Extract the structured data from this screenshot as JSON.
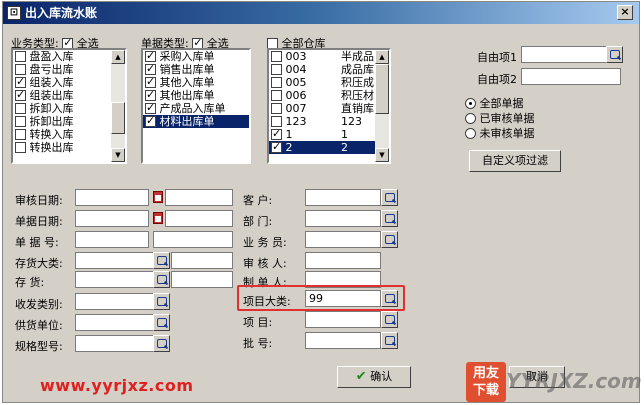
{
  "window": {
    "title": "出入库流水账",
    "close": "×"
  },
  "business": {
    "label": "业务类型:",
    "select_all": "全选",
    "items": [
      "盘盈入库",
      "盘亏出库",
      "组装入库",
      "组装出库",
      "拆卸入库",
      "拆卸出库",
      "转换入库",
      "转换出库"
    ],
    "checked": [
      false,
      false,
      true,
      true,
      false,
      false,
      false,
      false
    ]
  },
  "doc_type": {
    "label": "单据类型:",
    "select_all": "全选",
    "items": [
      "采购入库单",
      "销售出库单",
      "其他入库单",
      "其他出库单",
      "产成品入库单",
      "材料出库单"
    ],
    "checked": [
      true,
      true,
      true,
      true,
      true,
      true
    ],
    "selected_index": 5
  },
  "warehouse": {
    "label": "全部仓库",
    "items": [
      [
        "003",
        "半成品"
      ],
      [
        "004",
        "成品库"
      ],
      [
        "005",
        "积压成"
      ],
      [
        "006",
        "积压材"
      ],
      [
        "007",
        "直销库"
      ],
      [
        "123",
        "123"
      ],
      [
        "1",
        "1"
      ],
      [
        "2",
        "2"
      ]
    ],
    "checked": [
      false,
      false,
      false,
      false,
      false,
      false,
      true,
      true
    ],
    "selected_index": 7
  },
  "custom": {
    "item1_label": "自由项1",
    "item2_label": "自由项2"
  },
  "audit_filter": {
    "options": [
      "全部单据",
      "已审核单据",
      "未审核单据"
    ],
    "selected": 0
  },
  "buttons": {
    "custom_filter": "自定义项过滤",
    "ok": "确认",
    "cancel": "取消"
  },
  "left_fields": {
    "audit_date": "审核日期:",
    "doc_date": "单据日期:",
    "doc_no": "单 据 号:",
    "inv_class": "存货大类:",
    "inventory": "存    货:",
    "rs_category": "收发类别:",
    "supplier": "供货单位:",
    "spec": "规格型号:"
  },
  "right_fields": {
    "customer": "客    户:",
    "department": "部    门:",
    "salesman": "业 务 员:",
    "auditor": "审 核 人:",
    "maker": "制 单 人:",
    "project_class": "项目大类:",
    "project": "项      目:",
    "batch": "批      号:",
    "project_class_value": "99"
  },
  "watermark": {
    "url": "www.yyrjxz.com",
    "logo": "用友\n下载",
    "brand": "YYRJXZ.com"
  }
}
